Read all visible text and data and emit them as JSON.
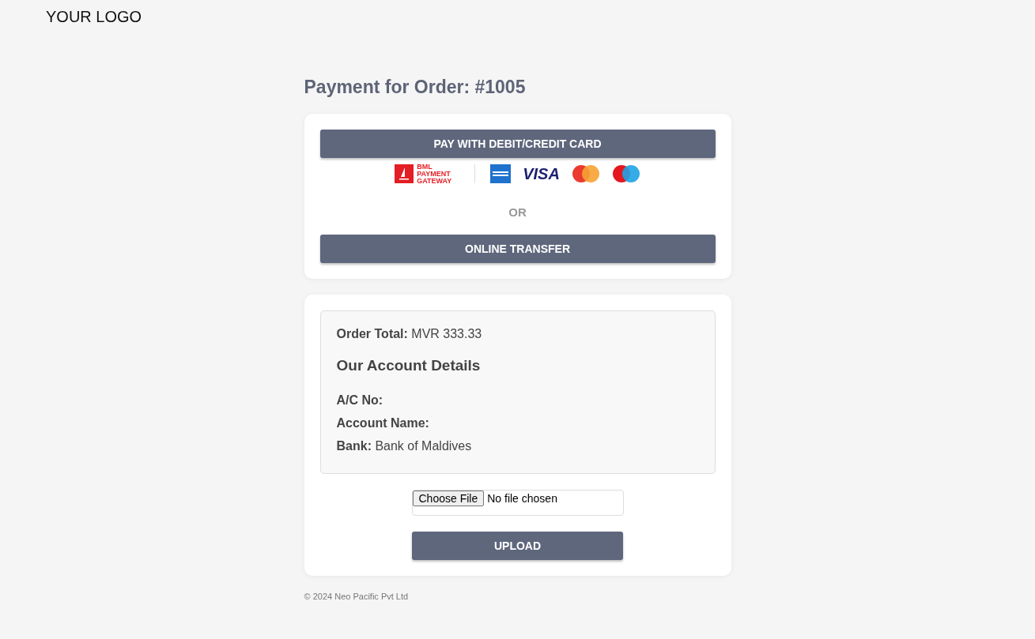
{
  "header": {
    "logo": "YOUR LOGO"
  },
  "title": "Payment for Order: #1005",
  "payment_card": {
    "card_button": "PAY WITH DEBIT/CREDIT CARD",
    "gateway_logo": "BML PAYMENT GATEWAY",
    "brands": [
      {
        "kind": "amex"
      },
      {
        "kind": "visa",
        "text": "VISA"
      },
      {
        "kind": "mastercard"
      },
      {
        "kind": "maestro"
      }
    ],
    "separator": "OR",
    "transfer_button": "ONLINE TRANSFER"
  },
  "transfer_card": {
    "details": [
      {
        "label": "Order Total:",
        "value": "MVR 333.33"
      }
    ],
    "heading": "Our Account Details",
    "account": [
      {
        "label": "A/C No:"
      },
      {
        "label": "Account Name:"
      },
      {
        "label": "Bank:",
        "value": "Bank of Maldives"
      }
    ],
    "file_button": "Choose File",
    "file_status": "No file chosen",
    "upload_button": "UPLOAD"
  },
  "footer": "© 2024 Neo Pacific Pvt Ltd"
}
